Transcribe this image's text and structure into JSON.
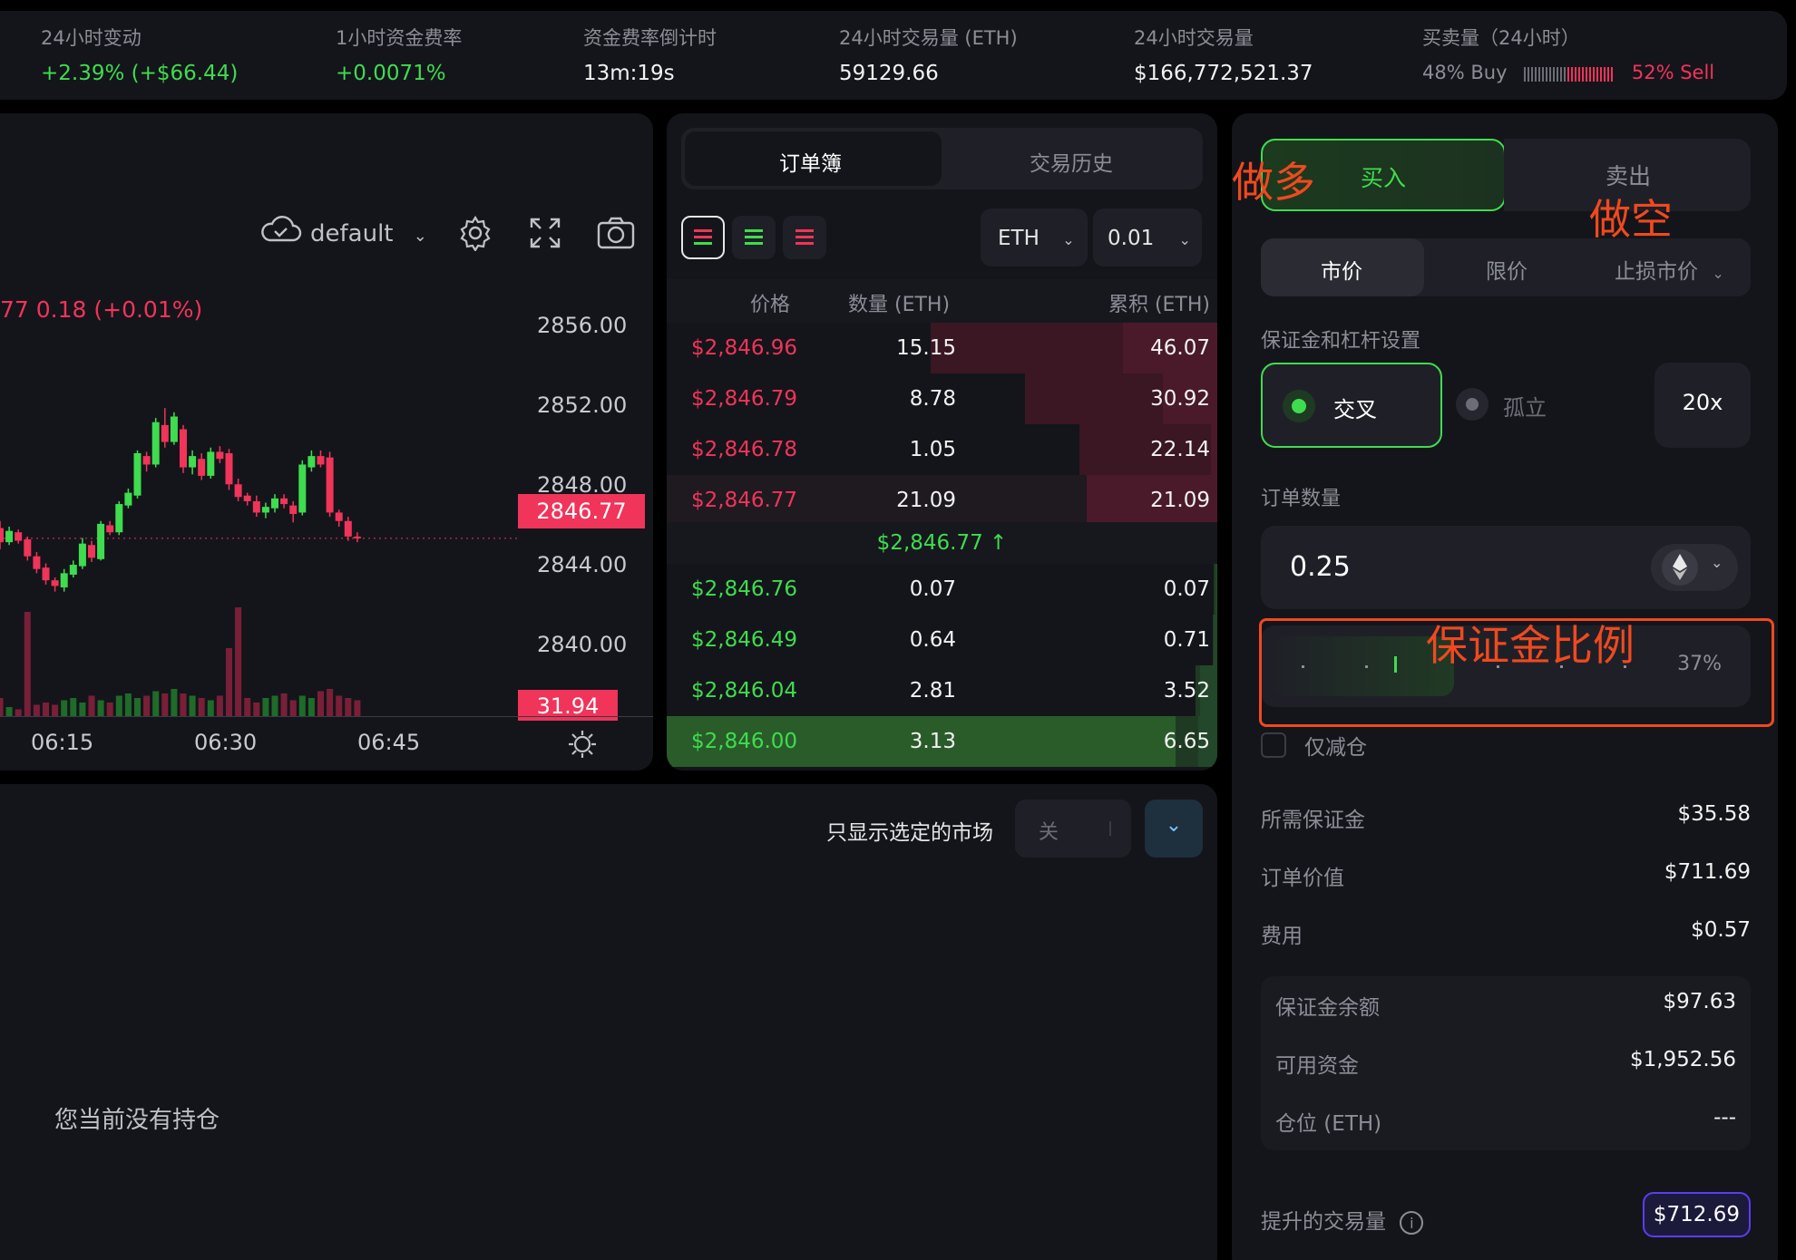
{
  "stats": [
    {
      "label": "24小时变动",
      "value": "+2.39% (+$66.44)"
    },
    {
      "label": "1小时资金费率",
      "value": "+0.0071%"
    },
    {
      "label": "资金费率倒计时",
      "value": "13m:19s"
    },
    {
      "label": "24小时交易量 (ETH)",
      "value": "59129.66"
    },
    {
      "label": "24小时交易量",
      "value": "$166,772,521.37"
    },
    {
      "label": "买卖量（24小时）",
      "buy": "48% Buy",
      "sell": "52% Sell"
    }
  ],
  "chart": {
    "theme_label": "default",
    "info_text": "77  0.18 (+0.01%)",
    "price_ticks": [
      "2856.00",
      "2852.00",
      "2848.00",
      "2844.00",
      "2840.00"
    ],
    "current_price_tag": "2846.77",
    "volume_tag": "31.94",
    "time_ticks": [
      "06:15",
      "06:30",
      "06:45"
    ]
  },
  "chart_data": {
    "type": "candlestick",
    "title": "",
    "ylim": [
      2838,
      2858
    ],
    "x": [
      "06:15",
      "06:30",
      "06:45"
    ],
    "current_price": 2846.77,
    "candles": [
      {
        "o": 2847.5,
        "c": 2846.5,
        "h": 2848.0,
        "l": 2846.0
      },
      {
        "o": 2846.5,
        "c": 2847.3,
        "h": 2847.6,
        "l": 2846.3
      },
      {
        "o": 2847.2,
        "c": 2846.6,
        "h": 2847.4,
        "l": 2846.4
      },
      {
        "o": 2846.7,
        "c": 2845.5,
        "h": 2846.9,
        "l": 2845.2
      },
      {
        "o": 2845.5,
        "c": 2844.6,
        "h": 2845.8,
        "l": 2844.3
      },
      {
        "o": 2844.7,
        "c": 2843.8,
        "h": 2845.0,
        "l": 2843.5
      },
      {
        "o": 2843.8,
        "c": 2843.4,
        "h": 2844.0,
        "l": 2843.0
      },
      {
        "o": 2843.3,
        "c": 2844.3,
        "h": 2844.6,
        "l": 2843.0
      },
      {
        "o": 2844.2,
        "c": 2844.9,
        "h": 2845.2,
        "l": 2844.0
      },
      {
        "o": 2844.8,
        "c": 2846.4,
        "h": 2846.8,
        "l": 2844.6
      },
      {
        "o": 2846.3,
        "c": 2845.4,
        "h": 2846.6,
        "l": 2845.1
      },
      {
        "o": 2845.3,
        "c": 2847.8,
        "h": 2848.0,
        "l": 2845.2
      },
      {
        "o": 2847.7,
        "c": 2847.2,
        "h": 2848.0,
        "l": 2847.0
      },
      {
        "o": 2847.2,
        "c": 2849.2,
        "h": 2849.4,
        "l": 2847.0
      },
      {
        "o": 2849.1,
        "c": 2850.0,
        "h": 2850.3,
        "l": 2848.9
      },
      {
        "o": 2849.8,
        "c": 2852.8,
        "h": 2853.0,
        "l": 2849.6
      },
      {
        "o": 2852.6,
        "c": 2852.0,
        "h": 2852.9,
        "l": 2851.5
      },
      {
        "o": 2852.0,
        "c": 2855.0,
        "h": 2855.3,
        "l": 2851.8
      },
      {
        "o": 2854.8,
        "c": 2853.6,
        "h": 2856.0,
        "l": 2853.2
      },
      {
        "o": 2853.6,
        "c": 2855.4,
        "h": 2855.7,
        "l": 2853.4
      },
      {
        "o": 2854.5,
        "c": 2851.8,
        "h": 2854.8,
        "l": 2851.4
      },
      {
        "o": 2851.8,
        "c": 2852.6,
        "h": 2853.0,
        "l": 2851.3
      },
      {
        "o": 2852.4,
        "c": 2851.2,
        "h": 2852.8,
        "l": 2850.9
      },
      {
        "o": 2851.2,
        "c": 2852.9,
        "h": 2853.2,
        "l": 2851.0
      },
      {
        "o": 2852.9,
        "c": 2852.4,
        "h": 2853.3,
        "l": 2852.1
      },
      {
        "o": 2852.8,
        "c": 2850.6,
        "h": 2853.1,
        "l": 2850.2
      },
      {
        "o": 2850.6,
        "c": 2849.7,
        "h": 2851.0,
        "l": 2849.4
      },
      {
        "o": 2849.8,
        "c": 2849.4,
        "h": 2850.0,
        "l": 2849.1
      },
      {
        "o": 2849.4,
        "c": 2848.6,
        "h": 2849.8,
        "l": 2848.3
      },
      {
        "o": 2848.6,
        "c": 2849.0,
        "h": 2849.3,
        "l": 2848.2
      },
      {
        "o": 2848.9,
        "c": 2849.6,
        "h": 2849.9,
        "l": 2848.6
      },
      {
        "o": 2849.6,
        "c": 2849.2,
        "h": 2849.9,
        "l": 2848.9
      },
      {
        "o": 2849.1,
        "c": 2848.5,
        "h": 2849.4,
        "l": 2847.9
      },
      {
        "o": 2848.6,
        "c": 2852.0,
        "h": 2852.3,
        "l": 2848.4
      },
      {
        "o": 2851.8,
        "c": 2852.6,
        "h": 2853.0,
        "l": 2851.5
      },
      {
        "o": 2852.6,
        "c": 2852.0,
        "h": 2853.0,
        "l": 2851.8
      },
      {
        "o": 2852.5,
        "c": 2848.6,
        "h": 2852.9,
        "l": 2848.3
      },
      {
        "o": 2848.6,
        "c": 2848.0,
        "h": 2848.8,
        "l": 2847.6
      },
      {
        "o": 2848.0,
        "c": 2846.9,
        "h": 2848.3,
        "l": 2846.6
      },
      {
        "o": 2846.9,
        "c": 2846.77,
        "h": 2847.2,
        "l": 2846.5
      }
    ],
    "volumes": [
      8,
      4,
      3,
      46,
      5,
      6,
      5,
      7,
      8,
      6,
      9,
      7,
      6,
      9,
      10,
      8,
      9,
      11,
      10,
      12,
      10,
      9,
      8,
      7,
      9,
      30,
      48,
      8,
      6,
      8,
      9,
      10,
      7,
      9,
      8,
      11,
      12,
      9,
      8,
      7
    ]
  },
  "orderbook": {
    "tabs": [
      "订单簿",
      "交易历史"
    ],
    "asset": "ETH",
    "tick_size": "0.01",
    "headers": [
      "价格",
      "数量 (ETH)",
      "累积 (ETH)"
    ],
    "asks": [
      {
        "price": "$2,846.96",
        "qty": "15.15",
        "cum": "46.07"
      },
      {
        "price": "$2,846.79",
        "qty": "8.78",
        "cum": "30.92"
      },
      {
        "price": "$2,846.78",
        "qty": "1.05",
        "cum": "22.14"
      },
      {
        "price": "$2,846.77",
        "qty": "21.09",
        "cum": "21.09"
      }
    ],
    "mid_price": "$2,846.77 ↑",
    "bids": [
      {
        "price": "$2,846.76",
        "qty": "0.07",
        "cum": "0.07"
      },
      {
        "price": "$2,846.49",
        "qty": "0.64",
        "cum": "0.71"
      },
      {
        "price": "$2,846.04",
        "qty": "2.81",
        "cum": "3.52"
      },
      {
        "price": "$2,846.00",
        "qty": "3.13",
        "cum": "6.65"
      }
    ]
  },
  "order_form": {
    "buy_label": "买入",
    "sell_label": "卖出",
    "order_types": [
      "市价",
      "限价",
      "止损市价"
    ],
    "margin_section_label": "保证金和杠杆设置",
    "margin_modes": [
      "交叉",
      "孤立"
    ],
    "leverage": "20x",
    "qty_label": "订单数量",
    "qty_value": "0.25",
    "slider_percent": "37%",
    "slider_fraction": 0.37,
    "reduce_only_label": "仅减仓",
    "summary": [
      {
        "label": "所需保证金",
        "value": "$35.58"
      },
      {
        "label": "订单价值",
        "value": "$711.69"
      },
      {
        "label": "费用",
        "value": "$0.57"
      }
    ],
    "account": [
      {
        "label": "保证金余额",
        "value": "$97.63"
      },
      {
        "label": "可用资金",
        "value": "$1,952.56"
      },
      {
        "label": "仓位 (ETH)",
        "value": "---"
      }
    ],
    "boost_label": "提升的交易量",
    "boost_value": "$712.69"
  },
  "positions": {
    "filter_label": "只显示选定的市场",
    "toggle_label": "关",
    "empty_text": "您当前没有持仓"
  },
  "annotations": {
    "long": "做多",
    "short": "做空",
    "margin_ratio": "保证金比例"
  },
  "colors": {
    "up": "#3fdc4f",
    "down": "#f0345a",
    "annotation": "#f0491f",
    "boost_border": "#5b3df5"
  }
}
